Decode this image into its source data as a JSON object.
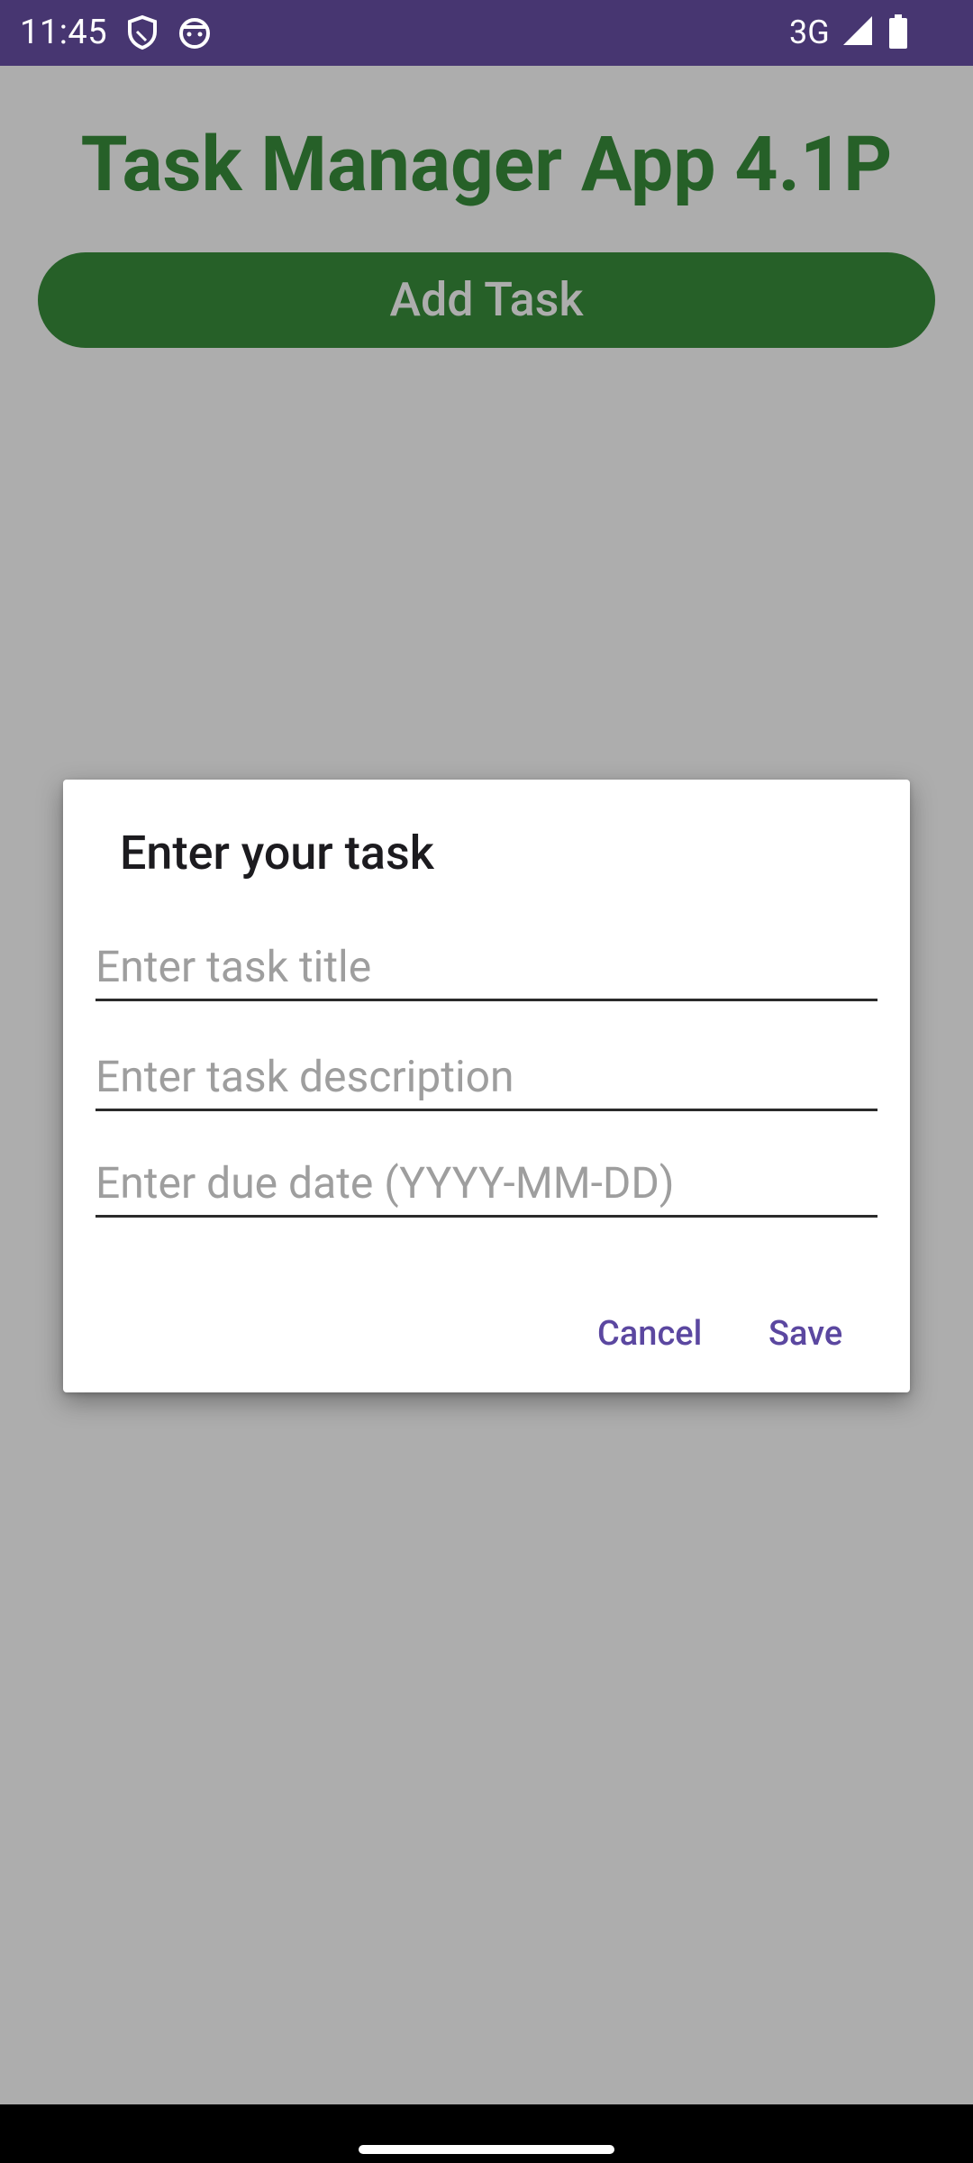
{
  "status_bar": {
    "time": "11:45",
    "network": "3G",
    "icons": [
      "shield-icon",
      "android-face-icon",
      "signal-icon",
      "battery-icon"
    ]
  },
  "app": {
    "title": "Task Manager App 4.1P",
    "add_task_label": "Add Task"
  },
  "dialog": {
    "title": "Enter your task",
    "fields": [
      {
        "placeholder": "Enter task title",
        "value": ""
      },
      {
        "placeholder": "Enter task description",
        "value": ""
      },
      {
        "placeholder": "Enter due date (YYYY-MM-DD)",
        "value": ""
      }
    ],
    "cancel_label": "Cancel",
    "save_label": "Save"
  },
  "colors": {
    "status_bar": "#473671",
    "accent_green": "#388e3c",
    "dialog_button": "#5b47a0"
  }
}
